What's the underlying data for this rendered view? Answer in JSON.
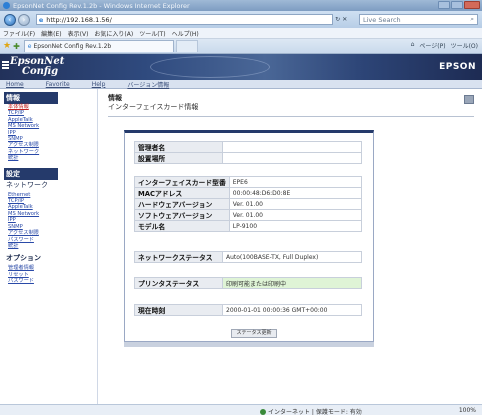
{
  "window": {
    "title": "EpsonNet Config Rev.1.2b - Windows Internet Explorer",
    "url": "http://192.168.1.56/",
    "search_placeholder": "Live Search"
  },
  "menubar": [
    "ファイル(F)",
    "編集(E)",
    "表示(V)",
    "お気に入り(A)",
    "ツール(T)",
    "ヘルプ(H)"
  ],
  "tab": {
    "label": "EpsonNet Config Rev.1.2b"
  },
  "command_bar": [
    "ページ(P)",
    "ツール(O)"
  ],
  "header": {
    "logo_line1": "EpsonNet",
    "logo_line2": "Config",
    "brand": "EPSON"
  },
  "navlinks": [
    "Home",
    "Favorite",
    "Help",
    "バージョン情報"
  ],
  "leftnav": {
    "info_section": {
      "head": "情報",
      "sub": "本体情報",
      "items": [
        "本体情報",
        "TCP/IP",
        "AppleTalk",
        "MS Network",
        "IPP",
        "SNMP",
        "アクセス制限",
        "ネットワーク",
        "統計"
      ]
    },
    "config_section": {
      "head": "設定",
      "sub": "ネットワーク",
      "items": [
        "Ethernet",
        "TCP/IP",
        "AppleTalk",
        "MS Network",
        "IPP",
        "SNMP",
        "アクセス制限",
        "パスワード",
        "統計"
      ]
    },
    "option_section": {
      "head": "オプション",
      "items": [
        "管理者情報",
        "リセット",
        "パスワード"
      ]
    }
  },
  "content": {
    "title": "情報",
    "subtitle": "インターフェイスカード情報",
    "admin_name_label": "管理者名",
    "admin_name_value": "",
    "location_label": "設置場所",
    "location_value": "",
    "rows": [
      {
        "label": "インターフェイスカード型番",
        "value": "EPE6"
      },
      {
        "label": "MACアドレス",
        "value": "00:00:48:D6:D0:8E"
      },
      {
        "label": "ハードウェアバージョン",
        "value": "Ver. 01.00"
      },
      {
        "label": "ソフトウェアバージョン",
        "value": "Ver. 01.00"
      },
      {
        "label": "モデル名",
        "value": "LP-9100"
      }
    ],
    "network_status_label": "ネットワークステータス",
    "network_status_value": "Auto(100BASE-TX, Full Duplex)",
    "printer_status_label": "プリンタステータス",
    "printer_status_value": "印刷可能または印刷中",
    "time_label": "現在時刻",
    "time_value": "2000-01-01 00:00:36 GMT+00:00",
    "update_button": "ステータス更新"
  },
  "statusbar": {
    "zone": "インターネット | 保護モード: 有効",
    "zoom": "100%"
  }
}
